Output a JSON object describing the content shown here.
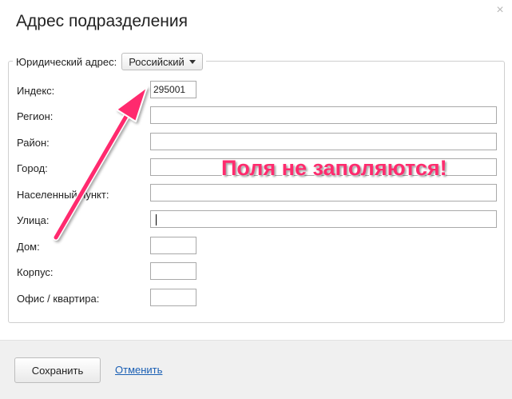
{
  "dialog": {
    "title": "Адрес подразделения",
    "close_glyph": "×"
  },
  "legal_address": {
    "label": "Юридический адрес:",
    "country_selected": "Российский"
  },
  "fields": {
    "index": {
      "label": "Индекс:",
      "value": "295001"
    },
    "region": {
      "label": "Регион:",
      "value": ""
    },
    "district": {
      "label": "Район:",
      "value": ""
    },
    "city": {
      "label": "Город:",
      "value": ""
    },
    "settlement": {
      "label": "Населенный пункт:",
      "value": ""
    },
    "street": {
      "label": "Улица:",
      "value": ""
    },
    "house": {
      "label": "Дом:",
      "value": ""
    },
    "building": {
      "label": "Корпус:",
      "value": ""
    },
    "office": {
      "label": "Офис / квартира:",
      "value": ""
    }
  },
  "footer": {
    "save_label": "Сохранить",
    "cancel_label": "Отменить"
  },
  "annotation": {
    "text": "Поля не заполяются!",
    "color": "#ff2b6e"
  }
}
